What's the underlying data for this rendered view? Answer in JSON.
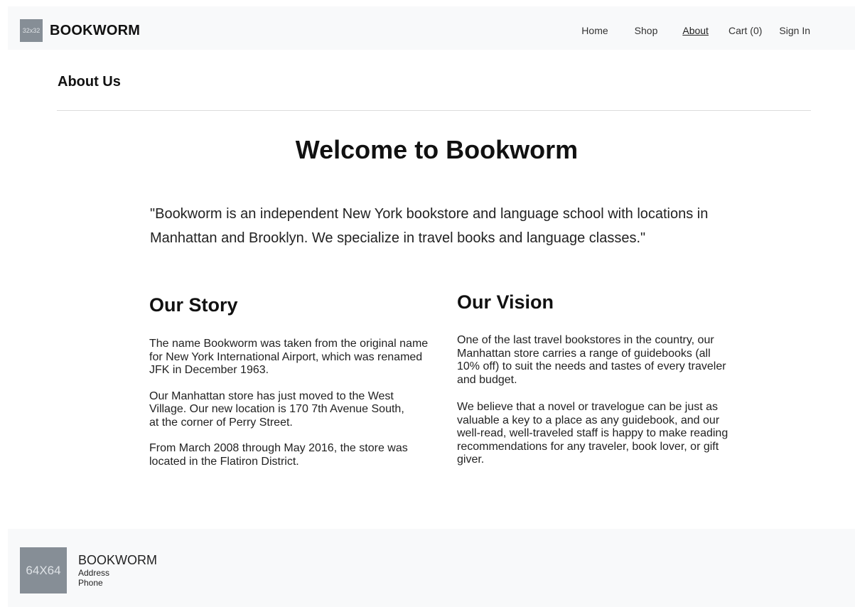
{
  "navbar": {
    "logo_placeholder": "32x32",
    "brand": "BOOKWORM",
    "links": [
      {
        "label": "Home"
      },
      {
        "label": "Shop"
      },
      {
        "label": "About"
      },
      {
        "label": "Cart (0)"
      },
      {
        "label": "Sign In"
      }
    ]
  },
  "page": {
    "title": "About Us"
  },
  "main": {
    "welcome": "Welcome to Bookworm",
    "quote": "\"Bookworm is an independent New York bookstore and language school with locations in Manhattan and Brooklyn. We specialize in travel books and language classes.\"",
    "story": {
      "title": "Our Story",
      "paragraphs": [
        "The name Bookworm was taken from the original name for New York International Airport, which was renamed JFK in December 1963.",
        "Our Manhattan store has just moved to the West Village. Our new location is 170 7th Avenue South, at the corner of Perry Street.",
        "From March 2008 through May 2016, the store was located in the Flatiron District."
      ]
    },
    "vision": {
      "title": "Our Vision",
      "paragraphs": [
        "One of the last travel bookstores in the country, our Manhattan store carries a range of guidebooks (all 10% off) to suit the needs and tastes of every traveler and budget.",
        "We believe that a novel or travelogue can be just as valuable a key to a place as any guidebook, and our well-read, well-traveled staff is happy to make reading recommendations for any traveler, book lover, or gift giver."
      ]
    }
  },
  "footer": {
    "logo_placeholder": "64X64",
    "brand": "BOOKWORM",
    "address": "Address",
    "phone": "Phone"
  },
  "colors": {
    "bar_background": "#f8f9fa",
    "placeholder_gray": "#868e96"
  }
}
